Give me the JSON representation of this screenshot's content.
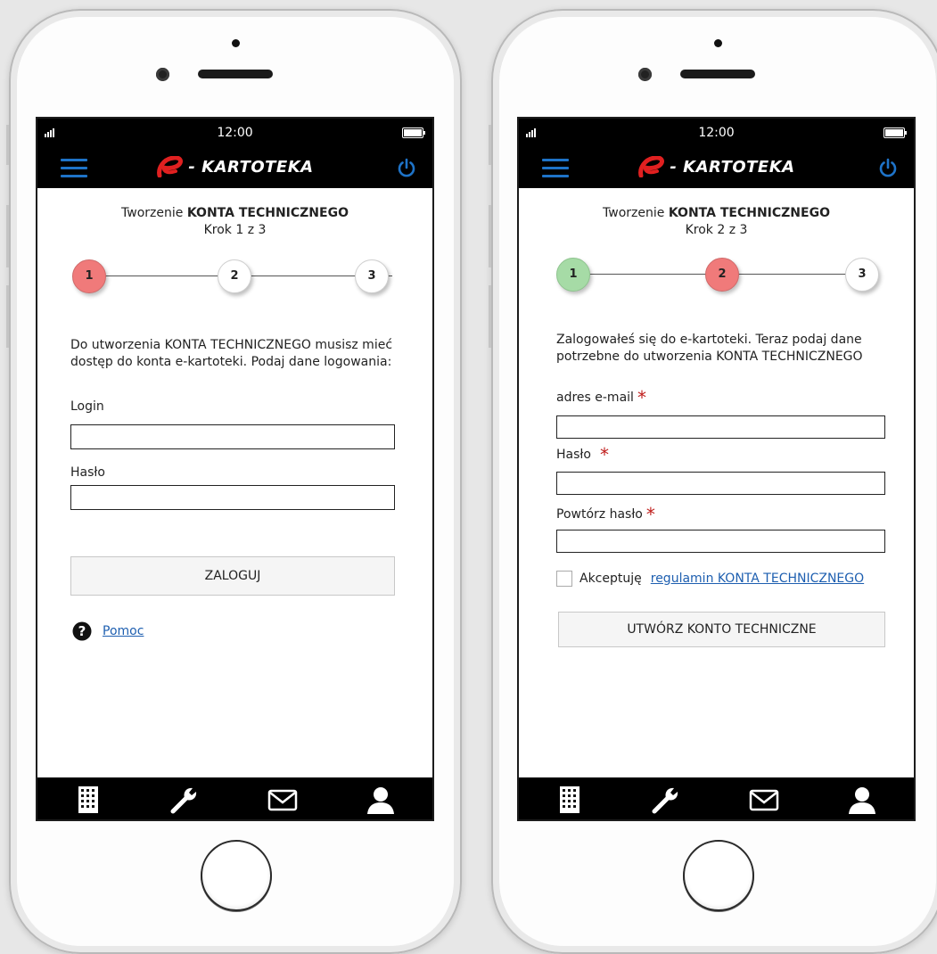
{
  "status": {
    "time": "12:00"
  },
  "brand": {
    "name": "- KARTOTEKA",
    "accent": "#1e73c8",
    "logo_red": "#e02020"
  },
  "screen1": {
    "title_prefix": "Tworzenie ",
    "title_bold": "KONTA TECHNICZNEGO",
    "step_text": "Krok 1 z 3",
    "steps": [
      "1",
      "2",
      "3"
    ],
    "description": "Do utworzenia KONTA TECHNICZNEGO musisz mieć dostęp do konta e-kartoteki. Podaj dane logowania:",
    "login_label": "Login",
    "password_label": "Hasło",
    "login_button": "ZALOGUJ",
    "help_link": "Pomoc"
  },
  "screen2": {
    "title_prefix": "Tworzenie ",
    "title_bold": "KONTA TECHNICZNEGO",
    "step_text": "Krok 2 z 3",
    "steps": [
      "1",
      "2",
      "3"
    ],
    "description": "Zalogowałeś się do e-kartoteki. Teraz podaj dane potrzebne do utworzenia KONTA TECHNICZNEGO",
    "email_label": "adres e-mail",
    "password_label": "Hasło",
    "repeat_password_label": "Powtórz hasło",
    "required_mark": "*",
    "accept_label": "Akceptuję",
    "terms_link": "regulamin KONTA TECHNICZNEGO",
    "create_button": "UTWÓRZ KONTO TECHNICZNE"
  },
  "tabbar": {
    "icons": [
      "building-icon",
      "wrench-icon",
      "envelope-icon",
      "user-icon"
    ]
  }
}
